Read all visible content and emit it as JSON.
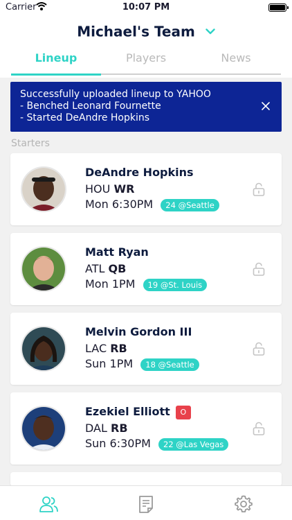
{
  "status_bar": {
    "carrier": "Carrier",
    "time": "10:07 PM"
  },
  "header": {
    "team_title": "Michael's Team"
  },
  "tabs": [
    {
      "label": "Lineup",
      "active": true
    },
    {
      "label": "Players",
      "active": false
    },
    {
      "label": "News",
      "active": false
    }
  ],
  "banner": {
    "lines": [
      "Successfully uploaded lineup to YAHOO",
      "- Benched Leonard Fournette",
      "- Started DeAndre Hopkins"
    ]
  },
  "section_label": "Starters",
  "players": [
    {
      "name": "DeAndre Hopkins",
      "team": "HOU",
      "position": "WR",
      "game_time": "Mon 6:30PM",
      "rank": "24 @Seattle",
      "status": ""
    },
    {
      "name": "Matt Ryan",
      "team": "ATL",
      "position": "QB",
      "game_time": "Mon 1PM",
      "rank": "19 @St. Louis",
      "status": ""
    },
    {
      "name": "Melvin Gordon III",
      "team": "LAC",
      "position": "RB",
      "game_time": "Sun 1PM",
      "rank": "18 @Seattle",
      "status": ""
    },
    {
      "name": "Ezekiel Elliott",
      "team": "DAL",
      "position": "RB",
      "game_time": "Sun 6:30PM",
      "rank": "22 @Las Vegas",
      "status": "O"
    }
  ],
  "tab_bar": {
    "icons": [
      "people-icon",
      "notes-icon",
      "gear-icon"
    ]
  },
  "colors": {
    "accent": "#2ed3c6",
    "banner": "#0d2595",
    "injury": "#e8414b",
    "navy_text": "#0d1b3e"
  }
}
